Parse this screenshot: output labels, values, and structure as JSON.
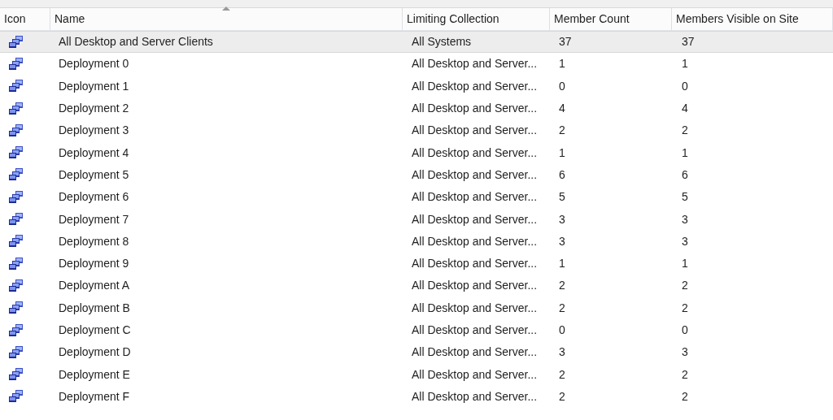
{
  "columns": [
    {
      "label": "Icon",
      "sorted": false
    },
    {
      "label": "Name",
      "sorted": true
    },
    {
      "label": "Limiting Collection",
      "sorted": false
    },
    {
      "label": "Member Count",
      "sorted": false
    },
    {
      "label": "Members Visible on Site",
      "sorted": false
    }
  ],
  "rows": [
    {
      "name": "All Desktop and Server Clients",
      "limiting": "All Systems",
      "count": "37",
      "visible": "37",
      "selected": true
    },
    {
      "name": "Deployment 0",
      "limiting": "All Desktop and Server...",
      "count": "1",
      "visible": "1",
      "selected": false
    },
    {
      "name": "Deployment 1",
      "limiting": "All Desktop and Server...",
      "count": "0",
      "visible": "0",
      "selected": false
    },
    {
      "name": "Deployment 2",
      "limiting": "All Desktop and Server...",
      "count": "4",
      "visible": "4",
      "selected": false
    },
    {
      "name": "Deployment 3",
      "limiting": "All Desktop and Server...",
      "count": "2",
      "visible": "2",
      "selected": false
    },
    {
      "name": "Deployment 4",
      "limiting": "All Desktop and Server...",
      "count": "1",
      "visible": "1",
      "selected": false
    },
    {
      "name": "Deployment 5",
      "limiting": "All Desktop and Server...",
      "count": "6",
      "visible": "6",
      "selected": false
    },
    {
      "name": "Deployment 6",
      "limiting": "All Desktop and Server...",
      "count": "5",
      "visible": "5",
      "selected": false
    },
    {
      "name": "Deployment 7",
      "limiting": "All Desktop and Server...",
      "count": "3",
      "visible": "3",
      "selected": false
    },
    {
      "name": "Deployment 8",
      "limiting": "All Desktop and Server...",
      "count": "3",
      "visible": "3",
      "selected": false
    },
    {
      "name": "Deployment 9",
      "limiting": "All Desktop and Server...",
      "count": "1",
      "visible": "1",
      "selected": false
    },
    {
      "name": "Deployment A",
      "limiting": "All Desktop and Server...",
      "count": "2",
      "visible": "2",
      "selected": false
    },
    {
      "name": "Deployment B",
      "limiting": "All Desktop and Server...",
      "count": "2",
      "visible": "2",
      "selected": false
    },
    {
      "name": "Deployment C",
      "limiting": "All Desktop and Server...",
      "count": "0",
      "visible": "0",
      "selected": false
    },
    {
      "name": "Deployment D",
      "limiting": "All Desktop and Server...",
      "count": "3",
      "visible": "3",
      "selected": false
    },
    {
      "name": "Deployment E",
      "limiting": "All Desktop and Server...",
      "count": "2",
      "visible": "2",
      "selected": false
    },
    {
      "name": "Deployment F",
      "limiting": "All Desktop and Server...",
      "count": "2",
      "visible": "2",
      "selected": false
    }
  ]
}
